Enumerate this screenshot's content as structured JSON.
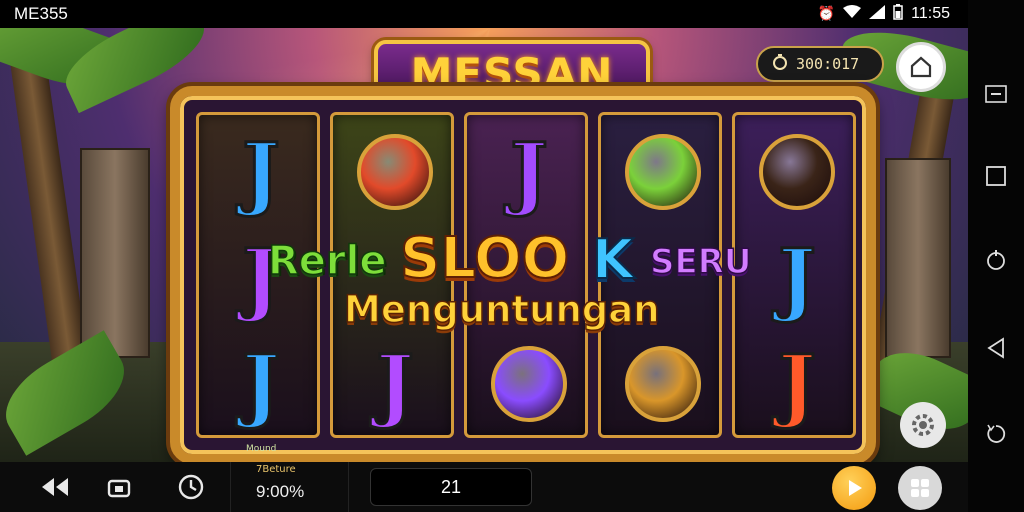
{
  "status_bar": {
    "carrier": "ME355",
    "time": "11:55"
  },
  "game": {
    "title": "MESSAN",
    "balance": "300:017",
    "promo": {
      "w1": "Rerle",
      "w2": "SLOO",
      "w3": "K",
      "w4": "SERU",
      "sub": "Menguntungan"
    },
    "reels": [
      {
        "symbols": [
          {
            "kind": "j",
            "color": "#38a8ff"
          },
          {
            "kind": "j",
            "color": "#b24cff"
          },
          {
            "kind": "j",
            "color": "#38a8ff"
          }
        ],
        "bg": "#3a2a1e"
      },
      {
        "symbols": [
          {
            "kind": "disc",
            "color": "#e24a2a"
          },
          {
            "kind": "blank",
            "color": "#3a4a1e"
          },
          {
            "kind": "j",
            "color": "#b24cff"
          }
        ],
        "bg": "#3d4518"
      },
      {
        "symbols": [
          {
            "kind": "j",
            "color": "#a34cff"
          },
          {
            "kind": "blank",
            "color": "#4a2a5a"
          },
          {
            "kind": "disc",
            "color": "#8a4cff"
          }
        ],
        "bg": "#4a2252"
      },
      {
        "symbols": [
          {
            "kind": "disc",
            "color": "#7bd13a"
          },
          {
            "kind": "blank",
            "color": "#2a1f40"
          },
          {
            "kind": "disc",
            "color": "#d9962a"
          }
        ],
        "bg": "#2a1f40"
      },
      {
        "symbols": [
          {
            "kind": "disc",
            "color": "#3a2418"
          },
          {
            "kind": "j",
            "color": "#38a8ff"
          },
          {
            "kind": "j",
            "color": "#ff5a2a"
          }
        ],
        "bg": "#3c1f5a"
      }
    ]
  },
  "bottom_bar": {
    "mini_label": "Mound",
    "bet_label": "7Beture",
    "bet_value": "9:00%",
    "win_value": "21"
  },
  "colors": {
    "accent": "#f5c443",
    "spin": "#f49a0e"
  }
}
